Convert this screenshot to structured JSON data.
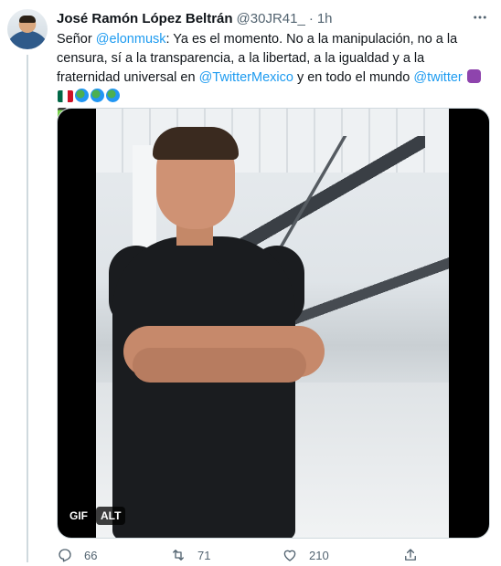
{
  "author": {
    "name": "José Ramón López Beltrán",
    "handle": "@30JR41_",
    "separator": "·",
    "time": "1h"
  },
  "tweet": {
    "text_1": "Señor ",
    "mention_elon": "@elonmusk",
    "text_2": ": Ya es el momento. No a la manipulación, no a la censura, sí a la transparencia, a la libertad, a la igualdad y a la fraternidad universal en ",
    "mention_mx": "@TwitterMexico",
    "text_3": " y en todo el mundo ",
    "mention_twitter": "@twitter",
    "text_end": "."
  },
  "media": {
    "gif_badge": "GIF",
    "alt_badge": "ALT"
  },
  "actions": {
    "replies": "66",
    "retweets": "71",
    "likes": "210"
  },
  "icons": {
    "more": "more-icon",
    "reply": "reply-icon",
    "retweet": "retweet-icon",
    "like": "heart-icon",
    "share": "share-icon"
  },
  "colors": {
    "link": "#1d9bf0",
    "secondary_text": "#536471",
    "primary_text": "#0f1419"
  }
}
